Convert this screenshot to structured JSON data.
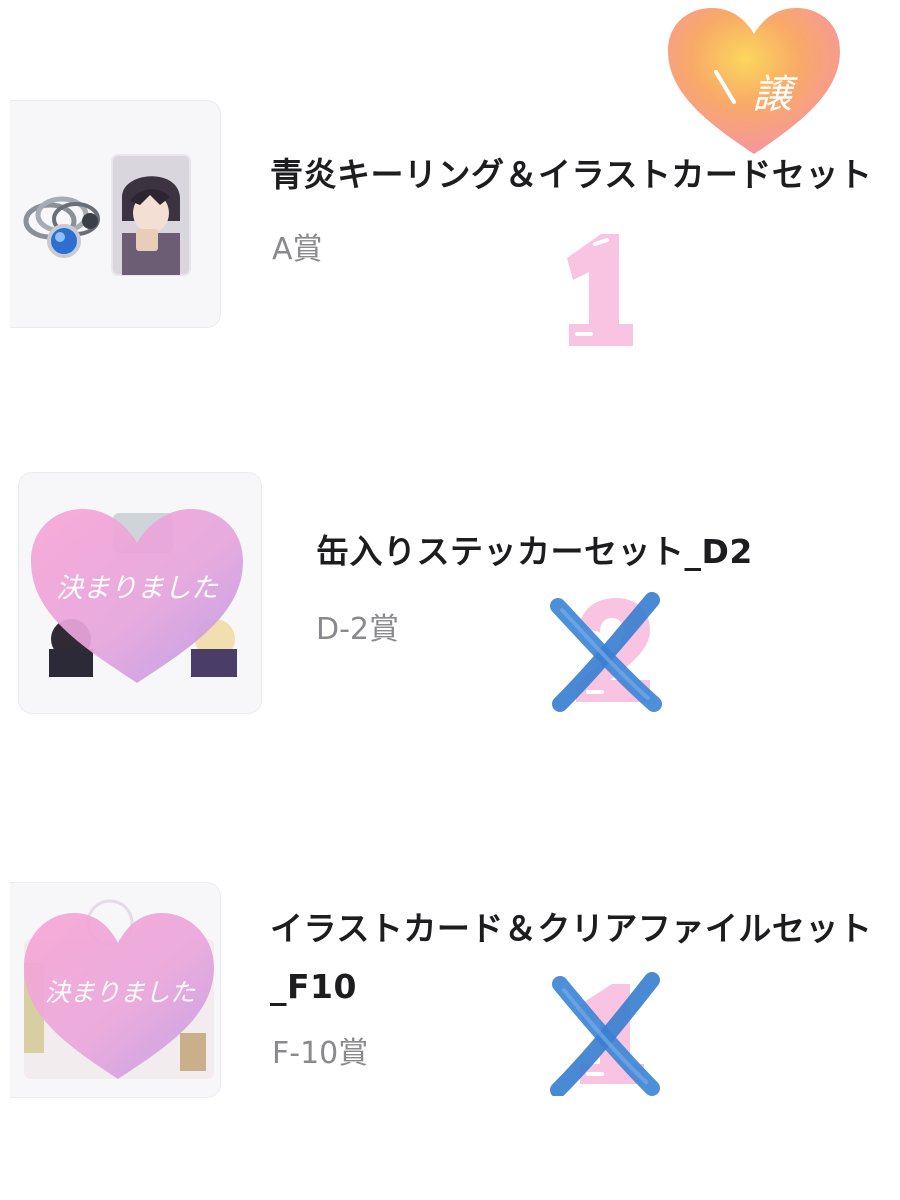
{
  "items": [
    {
      "title": "青炎キーリング＆イラストカードセット",
      "prize": "A賞",
      "number_mark": "1",
      "status_label": ""
    },
    {
      "title": "缶入りステッカーセット_D2",
      "prize": "D-2賞",
      "number_mark": "2",
      "status_label": "決まりました"
    },
    {
      "title": "イラストカード＆クリアファイルセット_F10",
      "prize": "F-10賞",
      "number_mark": "1",
      "status_label": "決まりました"
    }
  ],
  "corner_sticker": {
    "label": "譲"
  },
  "colors": {
    "number_pink": "#f7c6e0",
    "cross_blue": "#3f86d6",
    "heart_pink": "#f0a8d6",
    "heart_purple": "#c9a3e6",
    "heart_orange": "#f7a85a",
    "title": "#1d1d1f",
    "prize_gray": "#8a8a8e"
  },
  "icons": {
    "ring": "ring-icon",
    "photo": "illustration-card-image",
    "heart_sticker": "heart-sticker-icon",
    "cross": "cross-mark-icon",
    "number": "number-mark"
  }
}
